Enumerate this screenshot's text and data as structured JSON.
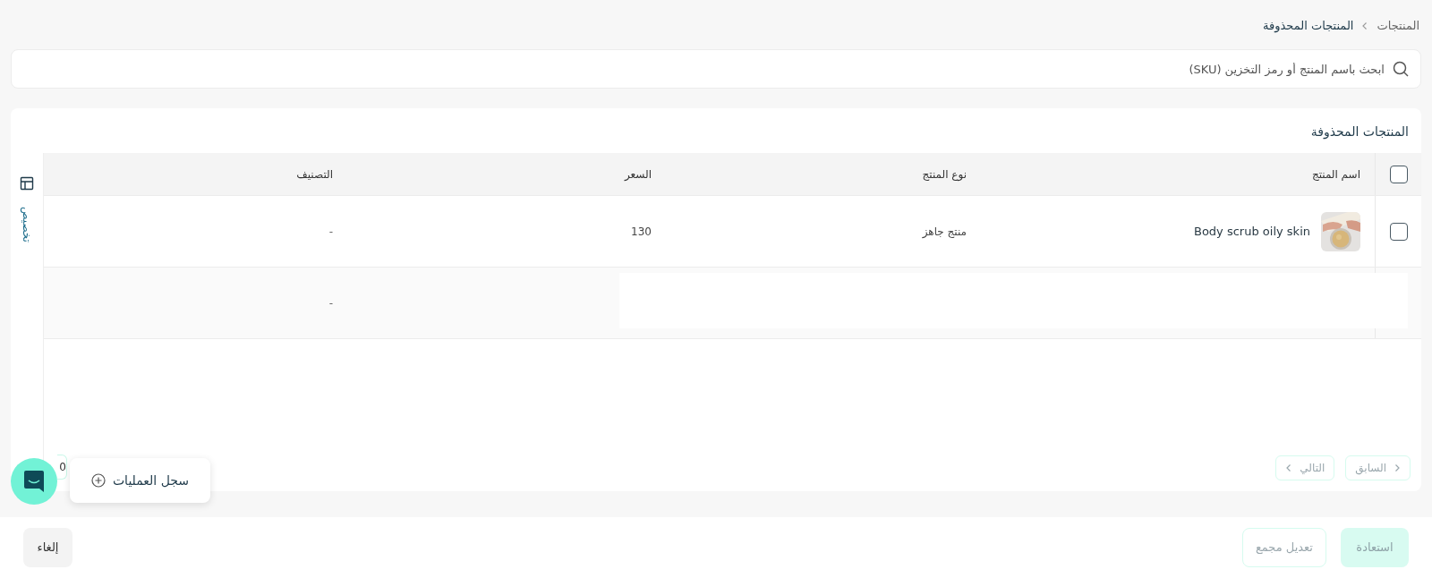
{
  "breadcrumb": [
    {
      "label": "المنتجات",
      "current": false
    },
    {
      "label": "المنتجات المحذوفة",
      "current": true
    }
  ],
  "search": {
    "placeholder": "ابحث باسم المنتج أو رمز التخزين (SKU)"
  },
  "card": {
    "title": "المنتجات المحذوفة",
    "customize_label": "تخصيص"
  },
  "table": {
    "select_all": {
      "checked": false
    },
    "columns": [
      "اسم المنتج",
      "نوع المنتج",
      "السعر",
      "التصنيف"
    ],
    "rows": [
      {
        "kind": "product",
        "checked": false,
        "name": "Body scrub oily skin",
        "type": "منتج جاهز",
        "price": "130",
        "category": "-"
      },
      {
        "kind": "partial",
        "category": "-"
      }
    ]
  },
  "pagination": {
    "previous": "السابق",
    "next": "التالي",
    "page_size": "0"
  },
  "activity_log": {
    "label": "سجل العمليات"
  },
  "footer": {
    "buttons": [
      {
        "label": "استعادة",
        "kind": "primary",
        "disabled": true
      },
      {
        "label": "تعديل مجمع",
        "kind": "outline",
        "disabled": true
      },
      {
        "label": "إلغاء",
        "kind": "secondary",
        "disabled": false
      }
    ]
  }
}
